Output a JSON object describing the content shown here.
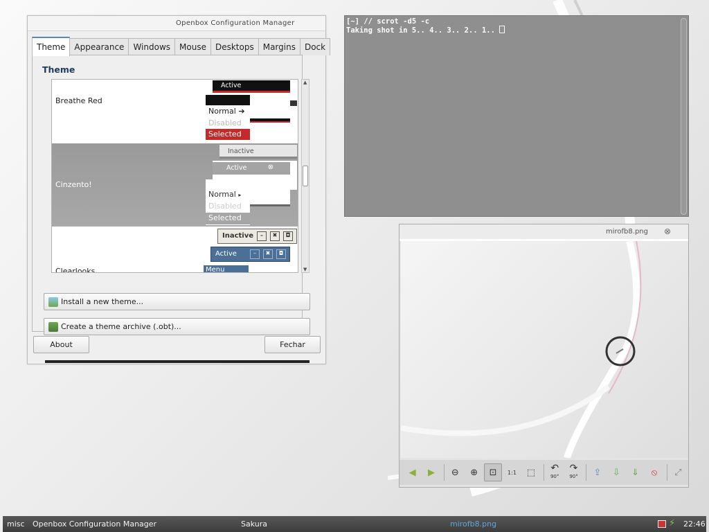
{
  "obconf": {
    "title": "Openbox Configuration Manager",
    "tabs": [
      {
        "label": "Theme"
      },
      {
        "label": "Appearance"
      },
      {
        "label": "Windows"
      },
      {
        "label": "Mouse"
      },
      {
        "label": "Desktops"
      },
      {
        "label": "Margins"
      },
      {
        "label": "Dock"
      }
    ],
    "section_title": "Theme",
    "themes": [
      {
        "name": "Breathe Red",
        "preview": {
          "active": "Active",
          "normal": "Normal",
          "disabled": "Disabled",
          "selected": "Selected"
        }
      },
      {
        "name": "Cinzento!",
        "preview": {
          "inactive": "Inactive",
          "active": "Active",
          "normal": "Normal",
          "disabled": "Disabled",
          "selected": "Selected"
        }
      },
      {
        "name": "Clearlooks",
        "preview": {
          "inactive": "Inactive",
          "active": "Active",
          "menu": "Menu"
        }
      }
    ],
    "install_button": "Install a new theme...",
    "archive_button": "Create a theme archive (.obt)...",
    "about_button": "About",
    "close_button": "Fechar"
  },
  "terminal": {
    "line1": "[~] // scrot -d5 -c",
    "line2": "Taking shot in 5.. 4.. 3.. 2.. 1.. "
  },
  "viewer": {
    "title": "mirofb8.png",
    "toolbar": [
      {
        "icon": "back-arrow-icon",
        "glyph": "◀"
      },
      {
        "icon": "forward-arrow-icon",
        "glyph": "▶"
      },
      {
        "icon": "zoom-out-icon",
        "glyph": "⊖"
      },
      {
        "icon": "zoom-in-icon",
        "glyph": "⊕"
      },
      {
        "icon": "zoom-fit-icon",
        "glyph": "⊡"
      },
      {
        "icon": "zoom-original-icon",
        "glyph": "1:1"
      },
      {
        "icon": "fit-window-icon",
        "glyph": "⬚"
      },
      {
        "icon": "rotate-left-icon",
        "glyph": "↶"
      },
      {
        "icon": "rotate-right-icon",
        "glyph": "↷"
      },
      {
        "icon": "open-file-icon",
        "glyph": "⇪"
      },
      {
        "icon": "save-file-icon",
        "glyph": "⇩"
      },
      {
        "icon": "save-as-icon",
        "glyph": "⇓"
      },
      {
        "icon": "delete-icon",
        "glyph": "⦸"
      },
      {
        "icon": "fullscreen-icon",
        "glyph": "⤢"
      }
    ],
    "rotate_left_label": "90°",
    "rotate_right_label": "90°"
  },
  "taskbar": {
    "menu": "misc",
    "tasks": [
      "Openbox Configuration Manager",
      "Sakura",
      "mirofb8.png"
    ],
    "clock": "22:46"
  },
  "colors": {
    "accent": "#5a86b7",
    "red": "#c42a2a",
    "terminal_bg": "#8f8f8f",
    "taskbar_bg": "#454545",
    "active_task": "#5fa8d8"
  }
}
